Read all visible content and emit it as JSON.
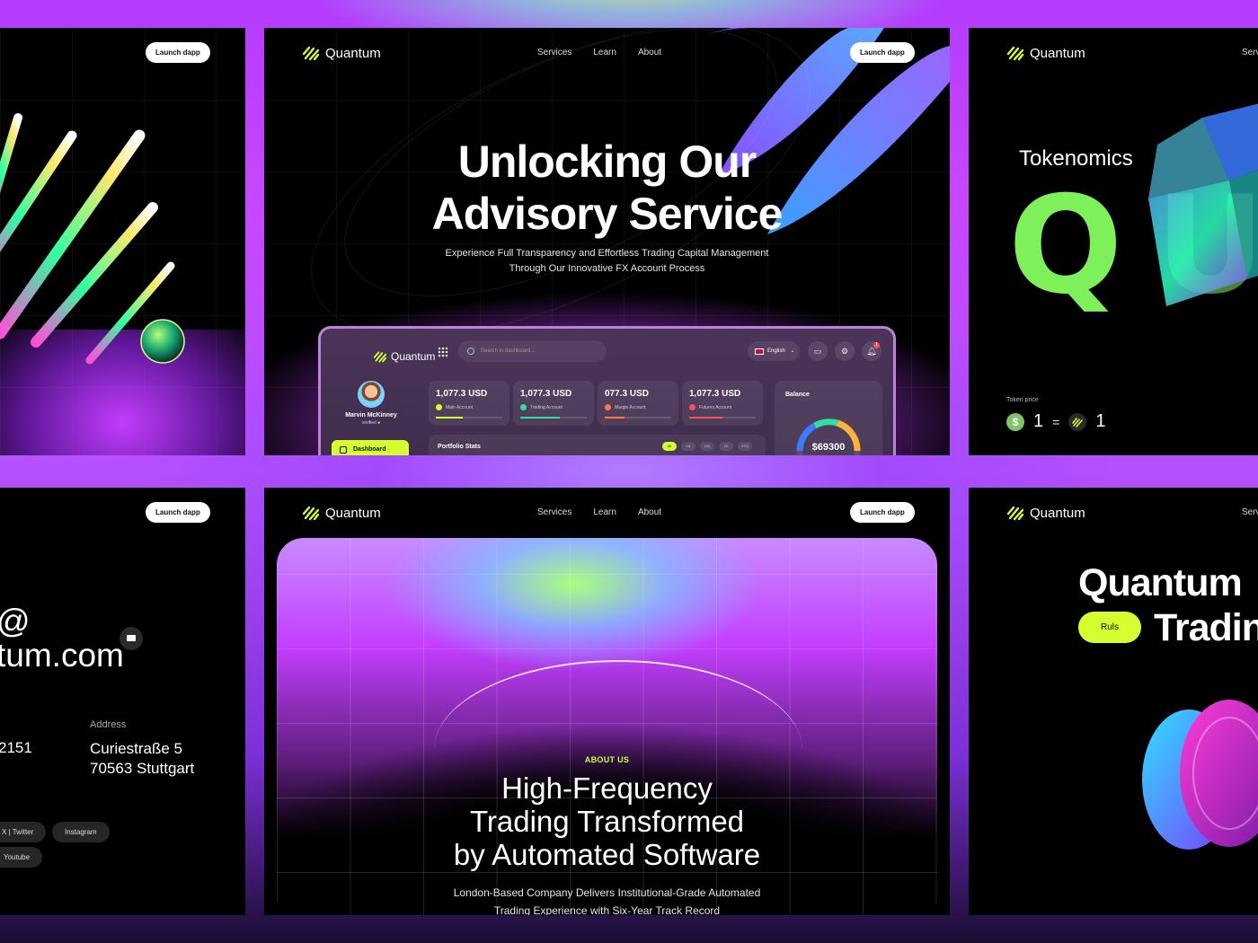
{
  "launch_label": "Launch dapp",
  "brand": "Quantum",
  "nav": [
    "Services",
    "Learn",
    "About"
  ],
  "hero": {
    "title_line1": "Unlocking Our",
    "title_line2": "Advisory Service",
    "subtitle_line1": "Experience Full Transparency and Effortless Trading Capital Management",
    "subtitle_line2": "Through Our Innovative FX Account Process"
  },
  "dashboard": {
    "brand": "Quantum",
    "search_placeholder": "Search in dashboard...",
    "language": "English",
    "notification_count": "1",
    "user_name": "Marvin McKinney",
    "user_status": "verified",
    "nav_active": "Dashboard",
    "accounts": [
      {
        "value": "1,077.3 USD",
        "label": "Main Account",
        "color": "#d6ff2f"
      },
      {
        "value": "1,077.3 USD",
        "label": "Trading Account",
        "color": "#2fe0a0"
      },
      {
        "value": "077.3 USD",
        "label": "Margin Account",
        "color": "#ff7a3d"
      },
      {
        "value": "1,077.3 USD",
        "label": "Futures Account",
        "color": "#ff4d5a"
      }
    ],
    "portfolio_title": "Portfolio Stats",
    "portfolio_ranges": [
      "All",
      "1d",
      "10d",
      "1h",
      "YTD"
    ],
    "balance_title": "Balance",
    "balance_value": "$69300"
  },
  "tokenomics": {
    "title": "Tokenomics",
    "letters": [
      "Q",
      "U"
    ],
    "price_label": "Token price",
    "price_left": "1",
    "equals": "=",
    "price_right": "1",
    "dollar": "$"
  },
  "contact": {
    "email_line1": "@",
    "email_line2": "tum.com",
    "phone": "2151",
    "address_label": "Address",
    "address_line1": "Curiestraße 5",
    "address_line2": "70563 Stuttgart",
    "socials": [
      "X | Twitter",
      "Instagram",
      "Youtube"
    ]
  },
  "about": {
    "label": "ABOUT US",
    "title_line1": "High-Frequency",
    "title_line2": "Trading Transformed",
    "title_line3": "by Automated Software",
    "subtitle_line1": "London-Based Company Delivers Institutional-Grade Automated",
    "subtitle_line2": "Trading Experience with Six-Year Track Record"
  },
  "quantum_trading": {
    "line1": "Quantum",
    "line2": "Tradin",
    "badge": "Ruls",
    "nav_partial": "Serv"
  },
  "colors": {
    "accent_lime": "#d6ff2f",
    "token_green": "#7df05a",
    "frame_purple": "#c746ff"
  }
}
